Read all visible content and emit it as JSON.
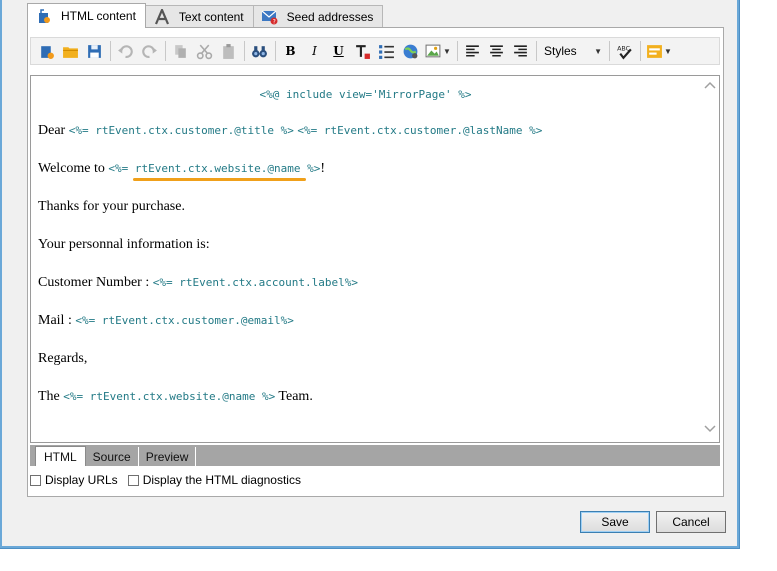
{
  "tabs": [
    {
      "label": "HTML content",
      "icon": "html-content-icon"
    },
    {
      "label": "Text content",
      "icon": "text-content-icon"
    },
    {
      "label": "Seed addresses",
      "icon": "seed-addresses-icon"
    }
  ],
  "toolbar": {
    "bold": "B",
    "italic": "I",
    "underline": "U",
    "styles_label": "Styles"
  },
  "editor": {
    "lines": [
      {
        "code": "<%@ include view='MirrorPage' %>"
      },
      {
        "text1": "Dear ",
        "code1": "<%= rtEvent.ctx.customer.@title %>",
        "code2": "<%= rtEvent.ctx.customer.@lastName %>"
      },
      {
        "text1": "Welcome to ",
        "code_pre": "<%= ",
        "code_hl": "rtEvent.ctx.website.@name",
        "code_post": " %>",
        "text2": "!"
      },
      {
        "text": "Thanks for your purchase."
      },
      {
        "text": "Your personnal information is:"
      },
      {
        "text1": "Customer Number : ",
        "code": "<%= rtEvent.ctx.account.label%>"
      },
      {
        "text1": "Mail : ",
        "code": "<%= rtEvent.ctx.customer.@email%>"
      },
      {
        "text": "Regards,"
      },
      {
        "text1": "The ",
        "code": "<%= rtEvent.ctx.website.@name %>",
        "text2": " Team."
      }
    ]
  },
  "mode_tabs": [
    "HTML",
    "Source",
    "Preview"
  ],
  "options": {
    "display_urls": "Display URLs",
    "display_diagnostics": "Display the HTML diagnostics"
  },
  "buttons": {
    "save": "Save",
    "cancel": "Cancel"
  },
  "colors": {
    "code": "#237a86",
    "highlight": "#f0a01a",
    "window_border": "#6aa8d8"
  }
}
